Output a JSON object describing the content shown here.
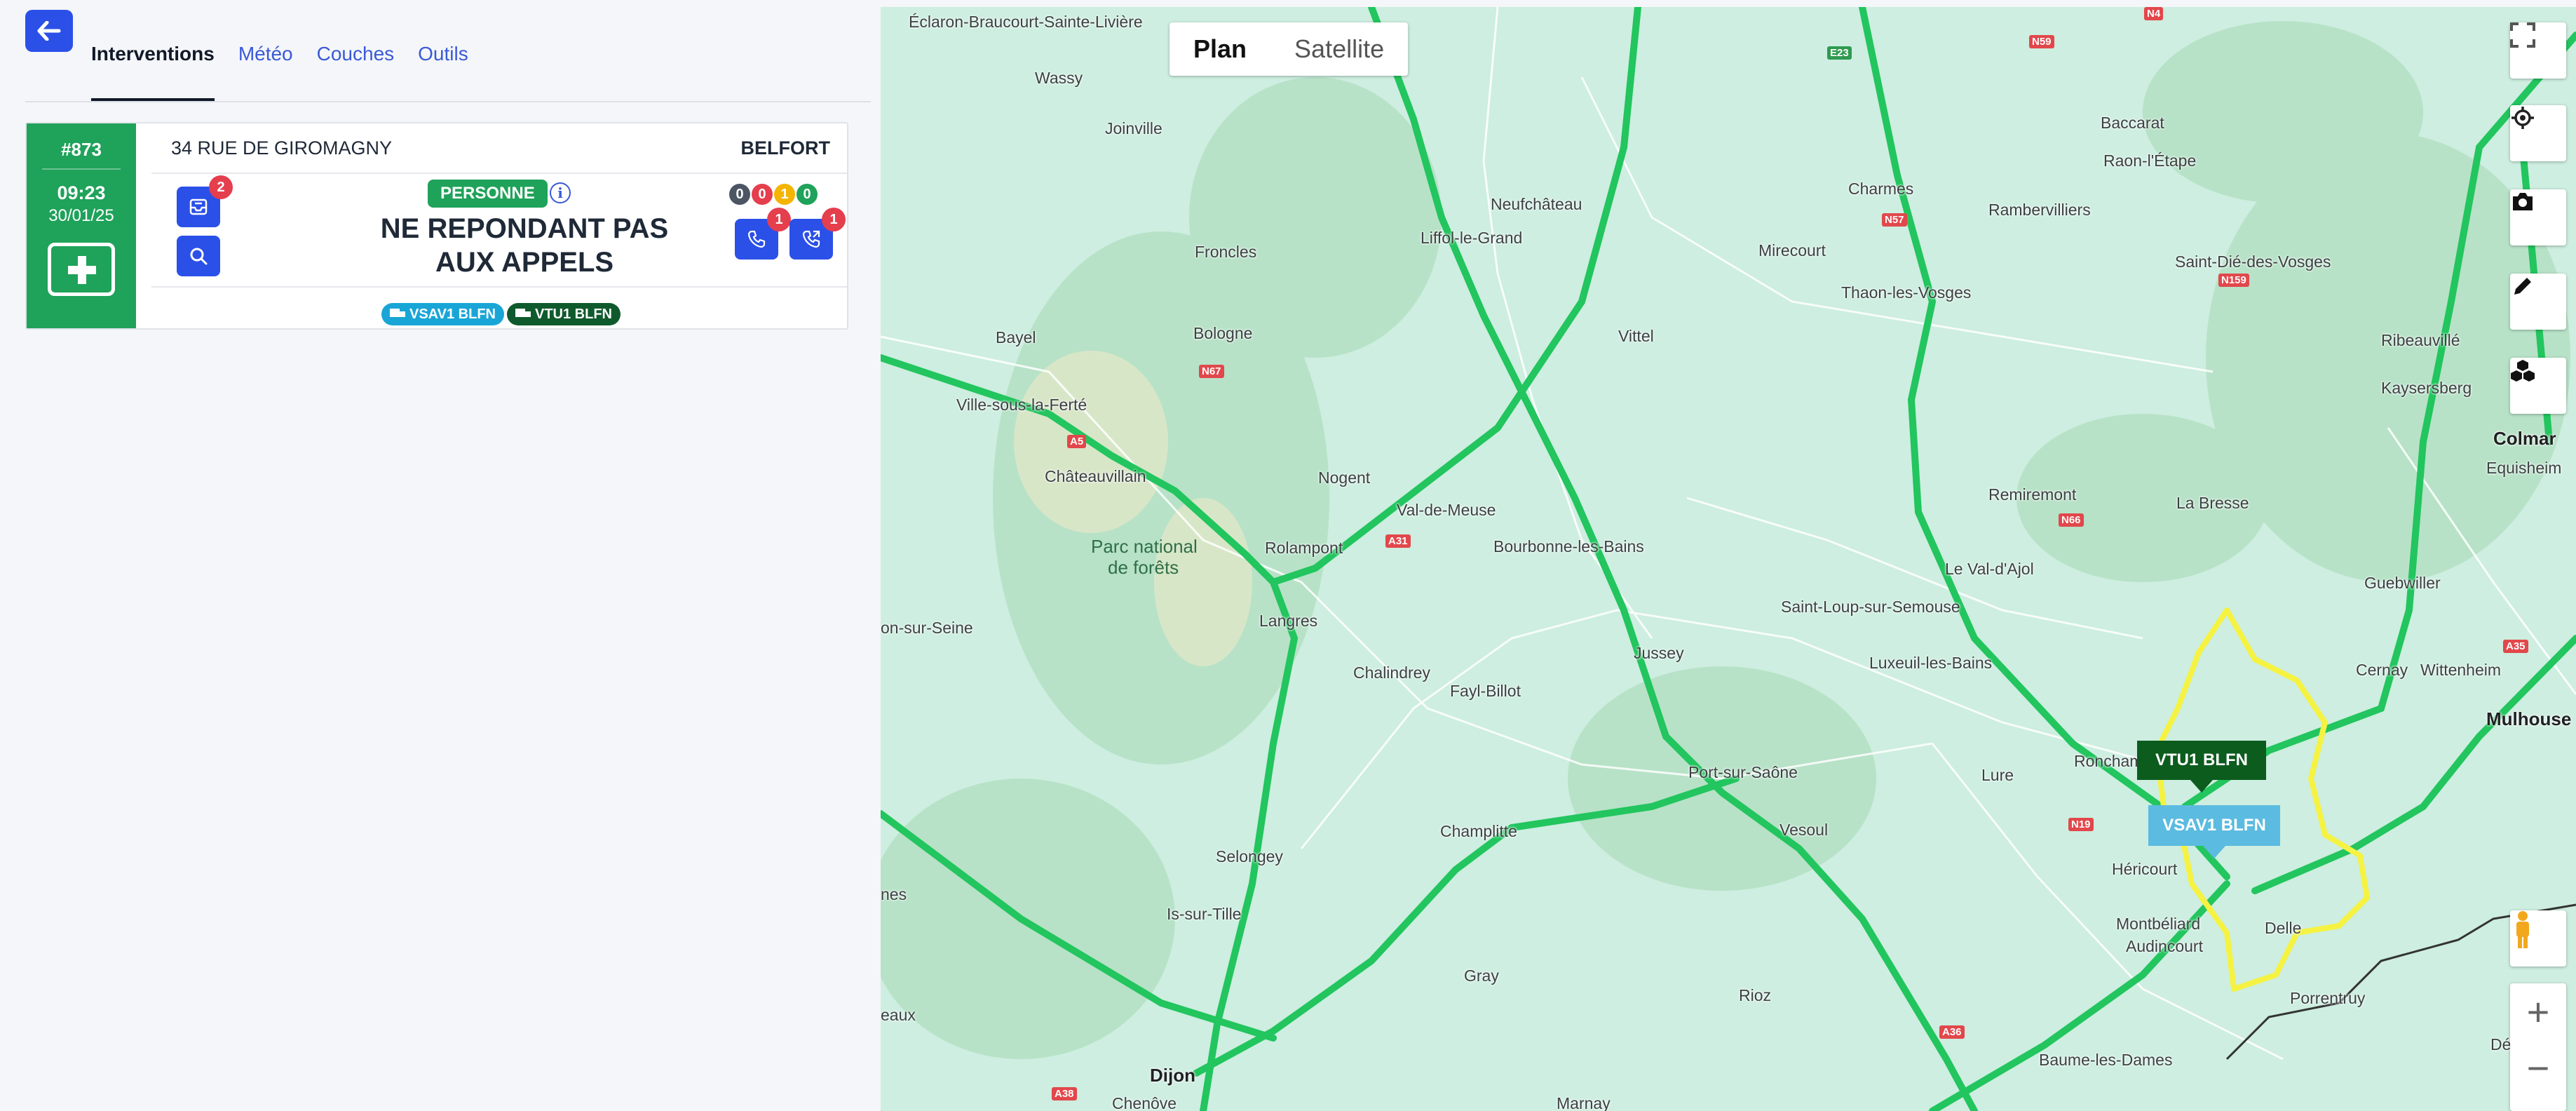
{
  "tabs": [
    {
      "label": "Interventions"
    },
    {
      "label": "Météo"
    },
    {
      "label": "Couches"
    },
    {
      "label": "Outils"
    }
  ],
  "card": {
    "id": "#873",
    "time": "09:23",
    "date": "30/01/25",
    "address": "34 RUE DE GIROMAGNY",
    "city": "BELFORT",
    "type_badge": "PERSONNE",
    "title_line1": "NE REPONDANT PAS",
    "title_line2": "AUX APPELS",
    "doc_badge": "2",
    "phone1_badge": "1",
    "phone2_badge": "1",
    "counters": [
      {
        "value": "0",
        "color": "#4b5563"
      },
      {
        "value": "0",
        "color": "#e53e4d"
      },
      {
        "value": "1",
        "color": "#f4b400"
      },
      {
        "value": "0",
        "color": "#1fa25a"
      }
    ],
    "vehicles": [
      {
        "label": "VSAV1 BLFN",
        "color": "#19a6d6"
      },
      {
        "label": "VTU1 BLFN",
        "color": "#0f5a2c"
      }
    ]
  },
  "map": {
    "type_plan": "Plan",
    "type_satellite": "Satellite",
    "markers": [
      {
        "label": "VTU1 BLFN",
        "color": "#0c5c1e"
      },
      {
        "label": "VSAV1 BLFN",
        "color": "#5bbbe0"
      }
    ],
    "places": [
      "Éclaron-Braucourt-Sainte-Livière",
      "Wassy",
      "Joinville",
      "Froncles",
      "Neufchâteau",
      "Liffol-le-Grand",
      "Charmes",
      "Rambervilliers",
      "Baccarat",
      "Raon-l'Étape",
      "Mirecourt",
      "Thaon-les-Vosges",
      "Saint-Dié-des-Vosges",
      "Bayel",
      "Bologne",
      "Vittel",
      "Ribeauvillé",
      "Kaysersberg",
      "Colmar",
      "Ville-sous-la-Ferté",
      "Châteauvillain",
      "Nogent",
      "Val-de-Meuse",
      "Remiremont",
      "Equisheim",
      "La Bresse",
      "Parc national",
      "de forêts",
      "Rolampont",
      "Bourbonne-les-Bains",
      "Le Val-d'Ajol",
      "Guebwiller",
      "on-sur-Seine",
      "Langres",
      "Saint-Loup-sur-Semouse",
      "Jussey",
      "Luxeuil-les-Bains",
      "Cernay",
      "Wittenheim",
      "Mulhouse",
      "Chalindrey",
      "Fayl-Billot",
      "Port-sur-Saône",
      "Lure",
      "Ronchamp",
      "Vesoul",
      "Héricourt",
      "Champlitte",
      "Selongey",
      "Montbéliard",
      "Audincourt",
      "Delle",
      "Is-sur-Tille",
      "nes",
      "Porrentruy",
      "Gray",
      "Rioz",
      "Délémo",
      "eaux",
      "Baume-les-Dames",
      "Dijon",
      "Chenôve",
      "Marnay"
    ],
    "road_labels": [
      "N4",
      "N59",
      "E23",
      "N57",
      "N159",
      "N67",
      "A5",
      "A31",
      "N66",
      "A35",
      "A36",
      "N19",
      "A38"
    ]
  },
  "colors": {
    "accent": "#2b50e8",
    "green": "#1fa25a",
    "red_badge": "#e53e4d"
  }
}
